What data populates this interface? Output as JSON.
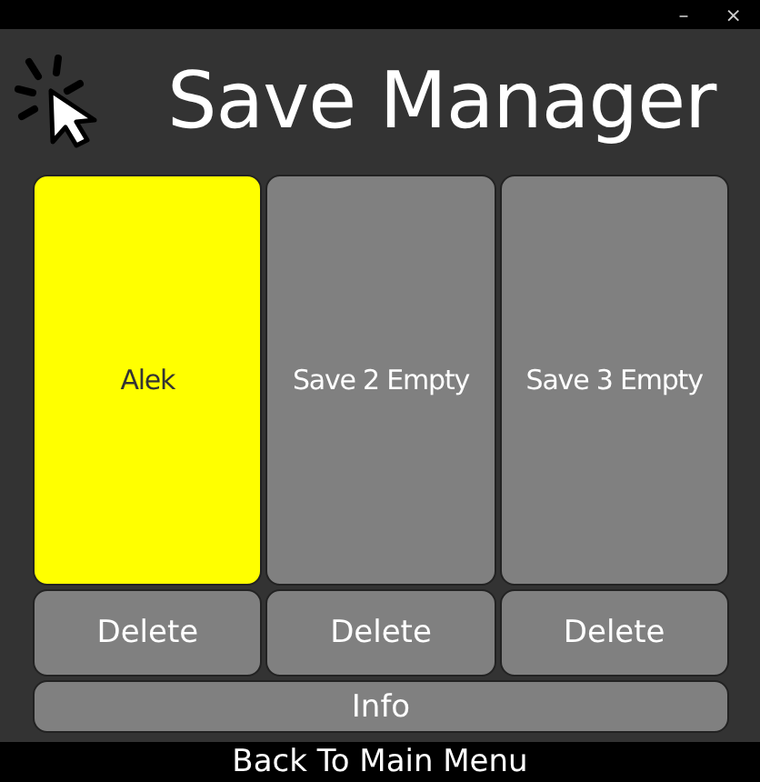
{
  "window": {
    "controls": [
      "–",
      "×"
    ]
  },
  "title": "Save Manager",
  "slots": [
    {
      "label": "Alek",
      "selected": true
    },
    {
      "label": "Save 2 Empty",
      "selected": false
    },
    {
      "label": "Save 3 Empty",
      "selected": false
    }
  ],
  "delete_buttons": [
    "Delete",
    "Delete",
    "Delete"
  ],
  "info_button": "Info",
  "back_button": "Back To Main Menu"
}
